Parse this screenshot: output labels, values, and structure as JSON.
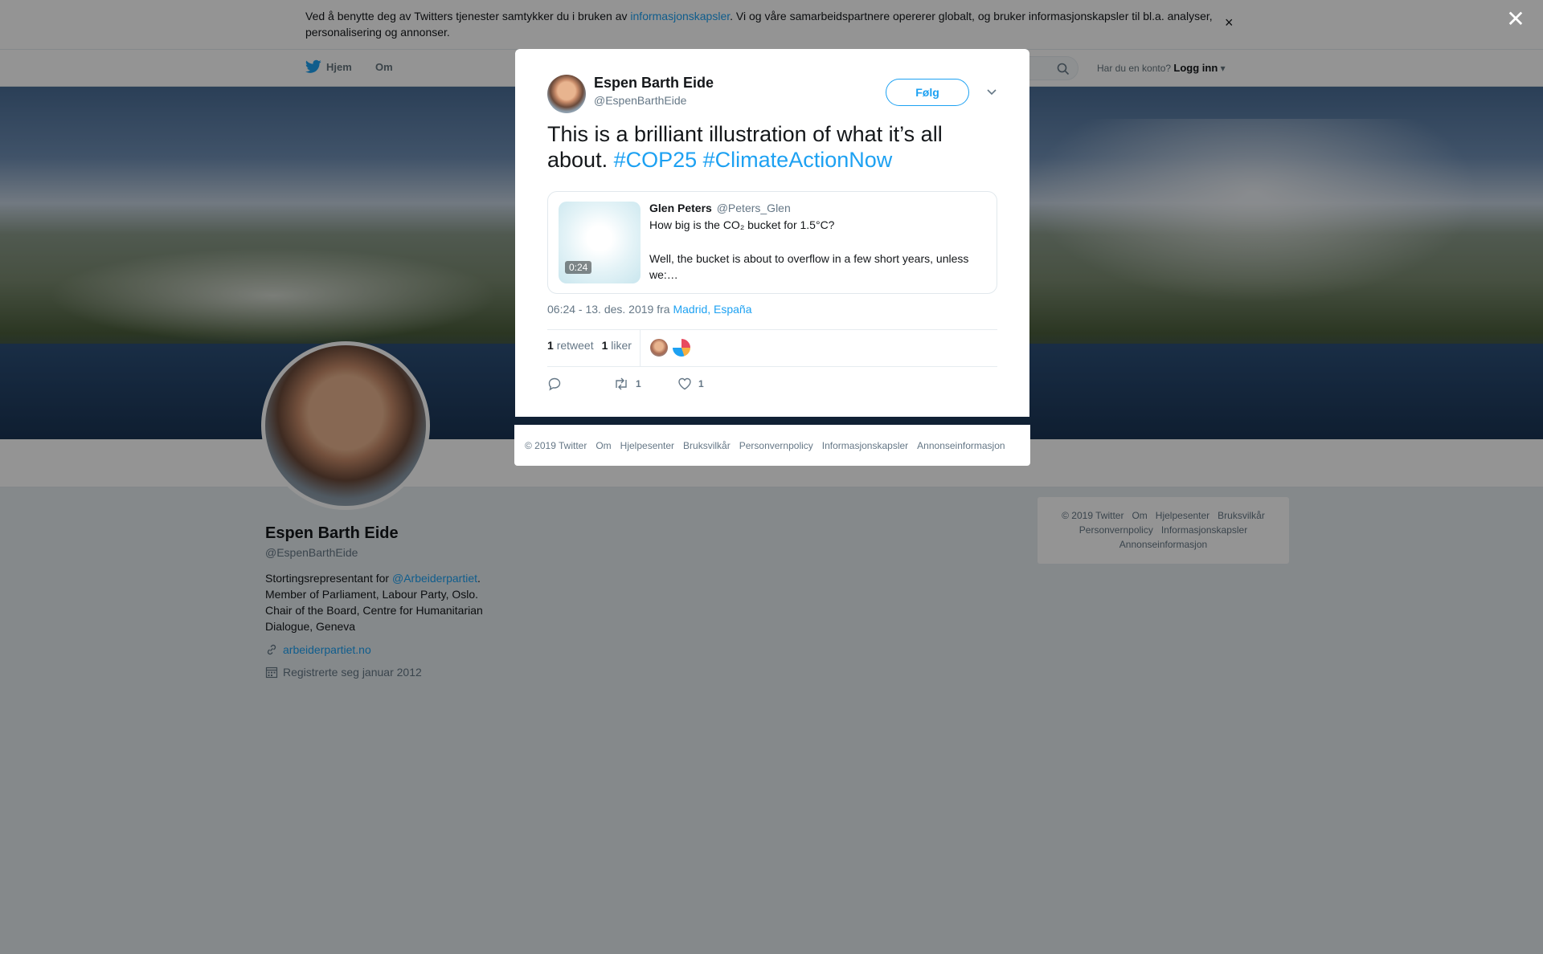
{
  "cookie": {
    "text_before": "Ved å benytte deg av Twitters tjenester samtykker du i bruken av ",
    "link": "informasjonskapsler",
    "text_after": ". Vi og våre samarbeidspartnere opererer globalt, og bruker informasjonskapsler til bl.a. analyser, personalisering og annonser.",
    "close_symbol": "×"
  },
  "nav": {
    "home": "Hjem",
    "about": "Om",
    "login_prompt": "Har du en konto?",
    "login": "Logg inn"
  },
  "profile": {
    "name": "Espen Barth Eide",
    "handle": "@EspenBarthEide",
    "bio_before": "Stortingsrepresentant for ",
    "bio_link": "@Arbeiderpartiet",
    "bio_after": ". Member of Parliament, Labour Party, Oslo. Chair of the Board, Centre for Humanitarian Dialogue, Geneva",
    "website": "arbeiderpartiet.no",
    "joined": "Registrerte seg januar 2012"
  },
  "side_footer": {
    "items": [
      "© 2019 Twitter",
      "Om",
      "Hjelpesenter",
      "Bruksvilkår",
      "Personvernpolicy",
      "Informasjonskapsler",
      "Annonseinformasjon"
    ]
  },
  "overlay": {
    "close_symbol": "✕"
  },
  "tweet": {
    "author_name": "Espen Barth Eide",
    "author_handle": "@EspenBarthEide",
    "follow_label": "Følg",
    "text": "This is a brilliant illustration of what it’s all about. ",
    "hashtags": [
      "#COP25",
      "#ClimateActionNow"
    ],
    "quoted": {
      "name": "Glen Peters",
      "handle": "@Peters_Glen",
      "line1": "How big is the CO₂ bucket for 1.5°C?",
      "line2": "Well, the bucket is about to overflow in a few short years, unless we:…",
      "duration": "0:24"
    },
    "timestamp": "06:24 - 13. des. 2019 fra ",
    "location": "Madrid, España",
    "retweets_count": "1",
    "retweets_label": "retweet",
    "likes_count": "1",
    "likes_label": "liker",
    "action_retweet_count": "1",
    "action_like_count": "1"
  },
  "modal_footer": {
    "items": [
      "© 2019 Twitter",
      "Om",
      "Hjelpesenter",
      "Bruksvilkår",
      "Personvernpolicy",
      "Informasjonskapsler",
      "Annonseinformasjon"
    ]
  },
  "colors": {
    "accent": "#1da1f2",
    "text": "#14171a",
    "muted": "#657786"
  }
}
